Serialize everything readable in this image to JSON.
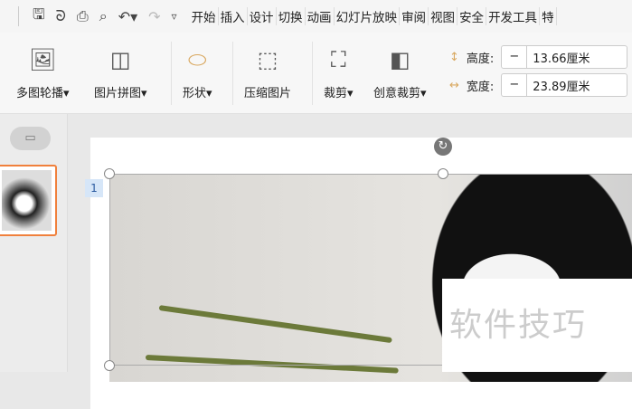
{
  "quick_access": {
    "icons": [
      "save-icon",
      "format-painter-icon",
      "print-icon",
      "print-preview-icon",
      "undo-icon",
      "redo-icon",
      "customize-icon"
    ]
  },
  "tabs": [
    "开始",
    "插入",
    "设计",
    "切换",
    "动画",
    "幻灯片放映",
    "审阅",
    "视图",
    "安全",
    "开发工具",
    "特"
  ],
  "ribbon": {
    "carousel": "多图轮播",
    "collage": "图片拼图",
    "shape": "形状",
    "compress": "压缩图片",
    "crop": "裁剪",
    "creative_crop": "创意裁剪",
    "height_label": "高度:",
    "height_value": "13.66厘米",
    "width_label": "宽度:",
    "width_value": "23.89厘米",
    "minus": "−"
  },
  "slide": {
    "number": "1"
  },
  "watermark": "软件技巧"
}
